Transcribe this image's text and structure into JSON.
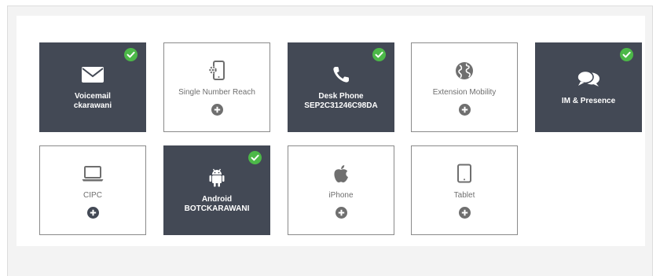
{
  "colors": {
    "tile_active_bg": "#434955",
    "tile_inactive_border": "#8a8a8a",
    "check_green": "#4cb848",
    "icon_gray": "#6f6f6f",
    "panel_bg": "#f3f3f3"
  },
  "tiles": [
    {
      "name": "Voicemail",
      "sub": "ckarawani",
      "active": true,
      "icon": "envelope-icon"
    },
    {
      "name": "Single Number Reach",
      "sub": "",
      "active": false,
      "icon": "phone-gear-icon"
    },
    {
      "name": "Desk Phone",
      "sub": "SEP2C31246C98DA",
      "active": true,
      "icon": "phone-handset-icon"
    },
    {
      "name": "Extension Mobility",
      "sub": "",
      "active": false,
      "icon": "globe-icon"
    },
    {
      "name": "IM & Presence",
      "sub": "",
      "active": true,
      "icon": "chat-bubbles-icon"
    },
    {
      "name": "CIPC",
      "sub": "",
      "active": false,
      "icon": "laptop-icon"
    },
    {
      "name": "Android",
      "sub": "BOTCKARAWANI",
      "active": true,
      "icon": "android-icon"
    },
    {
      "name": "iPhone",
      "sub": "",
      "active": false,
      "icon": "apple-icon"
    },
    {
      "name": "Tablet",
      "sub": "",
      "active": false,
      "icon": "tablet-icon"
    }
  ]
}
